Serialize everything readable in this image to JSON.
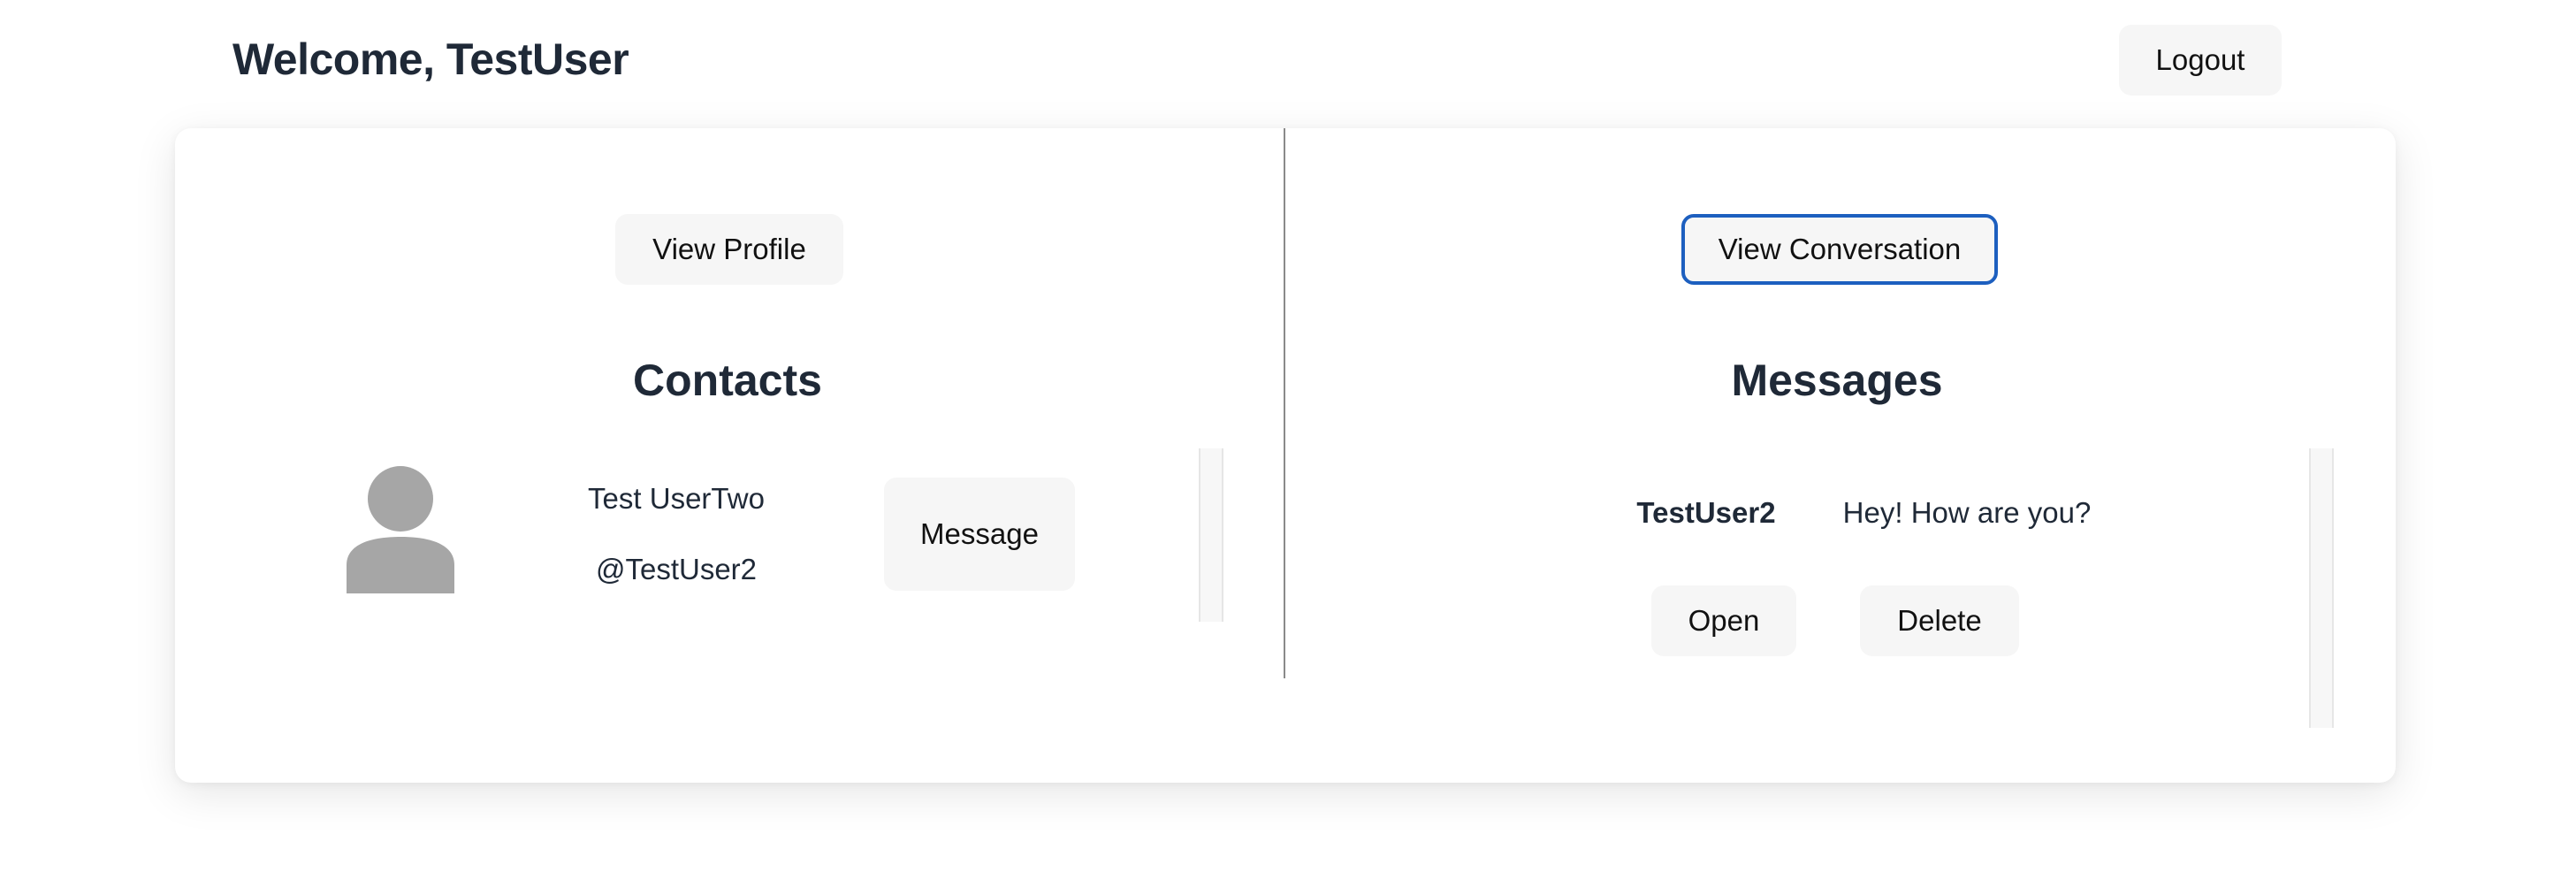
{
  "header": {
    "welcome_text": "Welcome, TestUser",
    "logout_label": "Logout"
  },
  "left_panel": {
    "view_profile_label": "View Profile",
    "title": "Contacts",
    "contacts": [
      {
        "name": "Test UserTwo",
        "handle": "@TestUser2",
        "avatar_icon": "user-silhouette-icon",
        "message_label": "Message"
      }
    ]
  },
  "right_panel": {
    "view_conversation_label": "View Conversation",
    "title": "Messages",
    "messages": [
      {
        "sender": "TestUser2",
        "preview": "Hey! How are you?",
        "open_label": "Open",
        "delete_label": "Delete"
      }
    ]
  },
  "colors": {
    "text_primary": "#1f2937",
    "button_bg": "#f6f6f6",
    "focus_ring": "#1d5fbf",
    "avatar": "#a6a6a6",
    "divider": "#8a8a8a"
  }
}
